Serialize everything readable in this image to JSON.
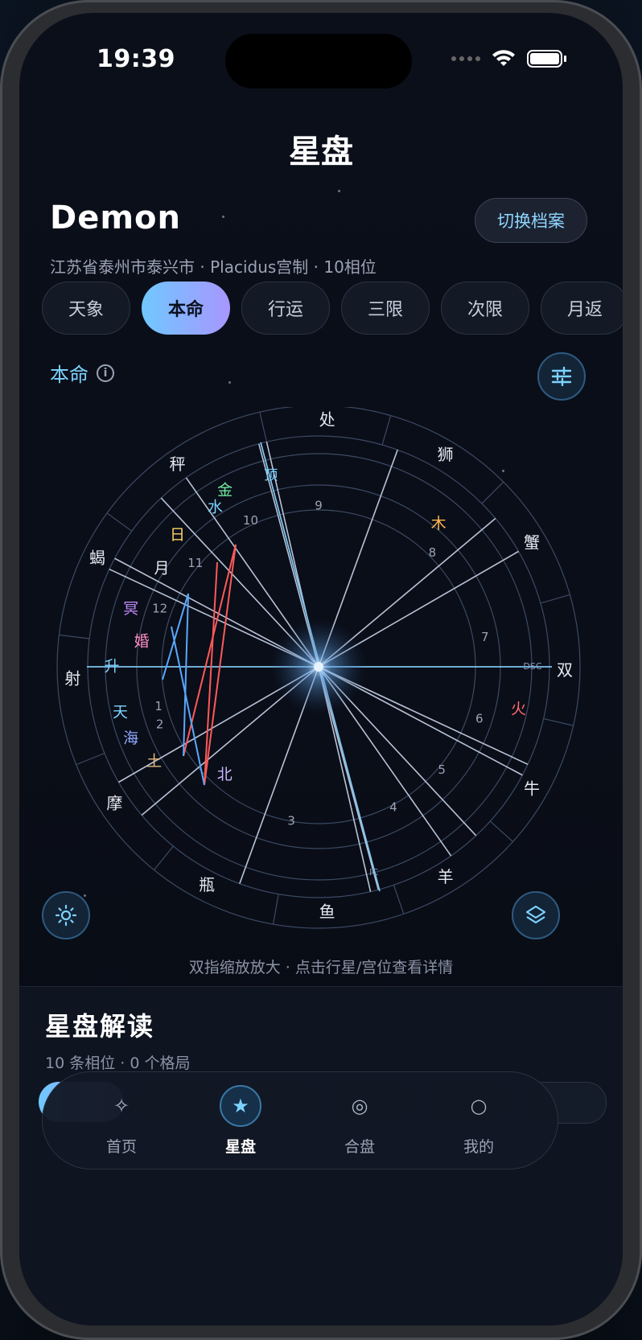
{
  "status_bar": {
    "time": "19:39"
  },
  "header": {
    "title": "星盘"
  },
  "profile": {
    "name": "Demon",
    "switch_label": "切换档案",
    "meta": "江苏省泰州市泰兴市 · Placidus宫制 · 10相位"
  },
  "chart_tabs": [
    {
      "label": "天象",
      "active": false
    },
    {
      "label": "本命",
      "active": true
    },
    {
      "label": "行运",
      "active": false
    },
    {
      "label": "三限",
      "active": false
    },
    {
      "label": "次限",
      "active": false
    },
    {
      "label": "月返",
      "active": false
    }
  ],
  "section": {
    "label": "本命"
  },
  "wheel": {
    "signs": [
      "处",
      "狮",
      "蟹",
      "双",
      "牛",
      "羊",
      "鱼",
      "瓶",
      "摩",
      "射",
      "蝎",
      "秤"
    ],
    "houses": [
      "1",
      "2",
      "3",
      "4",
      "5",
      "6",
      "7",
      "8",
      "9",
      "10",
      "11",
      "12"
    ],
    "planets": [
      {
        "label": "金",
        "color": "#6ee7a0"
      },
      {
        "label": "水",
        "color": "#7dd3ff"
      },
      {
        "label": "日",
        "color": "#ffd166"
      },
      {
        "label": "月",
        "color": "#e6e9f2"
      },
      {
        "label": "冥",
        "color": "#c58cff"
      },
      {
        "label": "婚",
        "color": "#ff8fc8"
      },
      {
        "label": "升",
        "color": "#7dd3ff"
      },
      {
        "label": "天",
        "color": "#7dd3ff"
      },
      {
        "label": "海",
        "color": "#8ea8ff"
      },
      {
        "label": "土",
        "color": "#e3b97a"
      },
      {
        "label": "北",
        "color": "#c8b6ff"
      },
      {
        "label": "木",
        "color": "#ffb454"
      },
      {
        "label": "火",
        "color": "#ff6b6b"
      }
    ],
    "angles": [
      "顶",
      "DSC",
      "IC"
    ]
  },
  "hint": "双指缩放放大 · 点击行星/宫位查看详情",
  "reading": {
    "title": "星盘解读",
    "subtitle": "10 条相位 · 0 个格局"
  },
  "tabbar": [
    {
      "label": "首页",
      "icon": "sparkle-icon",
      "active": false
    },
    {
      "label": "星盘",
      "icon": "star-icon",
      "active": true
    },
    {
      "label": "合盘",
      "icon": "double-circle-icon",
      "active": false
    },
    {
      "label": "我的",
      "icon": "circle-icon",
      "active": false
    }
  ]
}
